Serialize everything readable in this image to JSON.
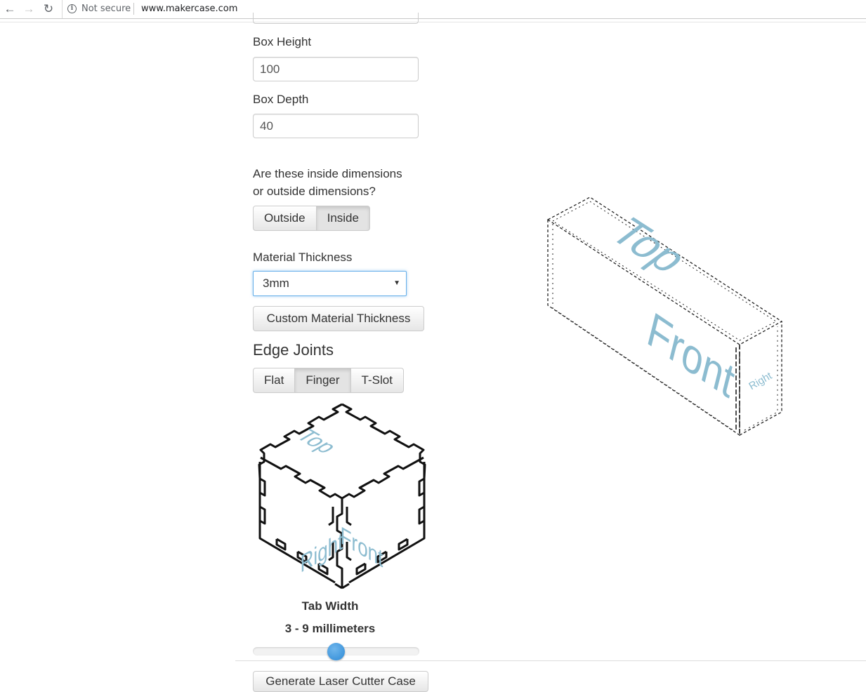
{
  "browser": {
    "back_icon": "←",
    "forward_icon": "→",
    "reload_icon": "↻",
    "info_icon": "i",
    "security_text": "Not secure",
    "url": "www.makercase.com"
  },
  "form": {
    "box_height": {
      "label": "Box Height",
      "value": "100"
    },
    "box_depth": {
      "label": "Box Depth",
      "value": "40"
    },
    "dimensions_question": {
      "line1": "Are these inside dimensions",
      "line2": "or outside dimensions?"
    },
    "dimension_options": [
      "Outside",
      "Inside"
    ],
    "dimension_selected": "Inside",
    "material_thickness": {
      "label": "Material Thickness",
      "selected": "3mm"
    },
    "custom_thickness_label": "Custom Material Thickness",
    "edge_joints_heading": "Edge Joints",
    "edge_joint_options": [
      "Flat",
      "Finger",
      "T-Slot"
    ],
    "edge_joint_selected": "Finger",
    "tab_width_title": "Tab Width",
    "tab_width_range": "3 - 9 millimeters",
    "tab_width_slider_position": 0.5,
    "generate_label": "Generate Laser Cutter Case"
  },
  "cube_preview": {
    "top_label": "Top",
    "front_label": "Front",
    "right_label": "Right"
  },
  "box_preview": {
    "top_label": "Top",
    "front_label": "Front",
    "right_label": "Right"
  },
  "colors": {
    "label_blue": "#8cbcd0",
    "focus_blue": "#66afe9",
    "slider_blue": "#2e8ad6"
  }
}
